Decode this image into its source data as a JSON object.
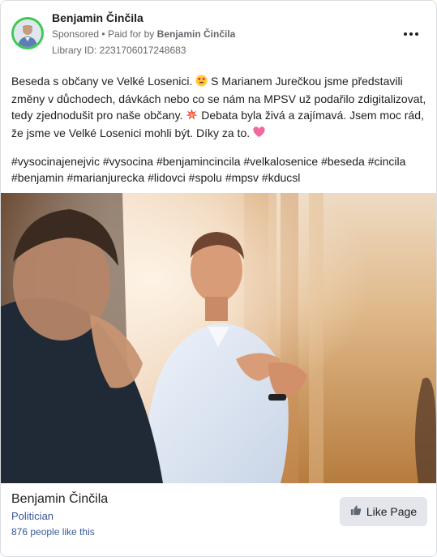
{
  "ad": {
    "page_name": "Benjamin Činčila",
    "sponsored_label": "Sponsored",
    "paid_for_prefix": "Paid for by",
    "paid_for_name": "Benjamin Činčila",
    "library_id": "Library ID: 2231706017248683",
    "more_icon": "more-horizontal-icon"
  },
  "post": {
    "text_part1": "Beseda s občany ve Velké Losenici.",
    "text_part2": "S Marianem Jurečkou jsme představili změny v důchodech, dávkách nebo co se nám na MPSV už podařilo zdigitalizovat, tedy zjednodušit pro naše občany.",
    "text_part3": "Debata byla živá a zajímavá. Jsem moc rád, že jsme ve Velké Losenici mohli být. Díky za to.",
    "hashtags": "#vysocinajenejvic #vysocina #benjamincincila #velkalosenice #beseda #cincila #benjamin #marianjurecka #lidovci #spolu #mpsv #kducsl",
    "emoji_1": "smiling-face-with-heart-eyes",
    "emoji_2": "collision",
    "emoji_3": "pink-heart"
  },
  "footer": {
    "page_name": "Benjamin Činčila",
    "category": "Politician",
    "likes": "876 people like this",
    "like_button_label": "Like Page",
    "like_icon": "thumbs-up-icon"
  },
  "colors": {
    "link": "#385898",
    "secondary_text": "#65676b",
    "avatar_ring": "#3cc94f",
    "button_bg": "#e4e6eb"
  }
}
